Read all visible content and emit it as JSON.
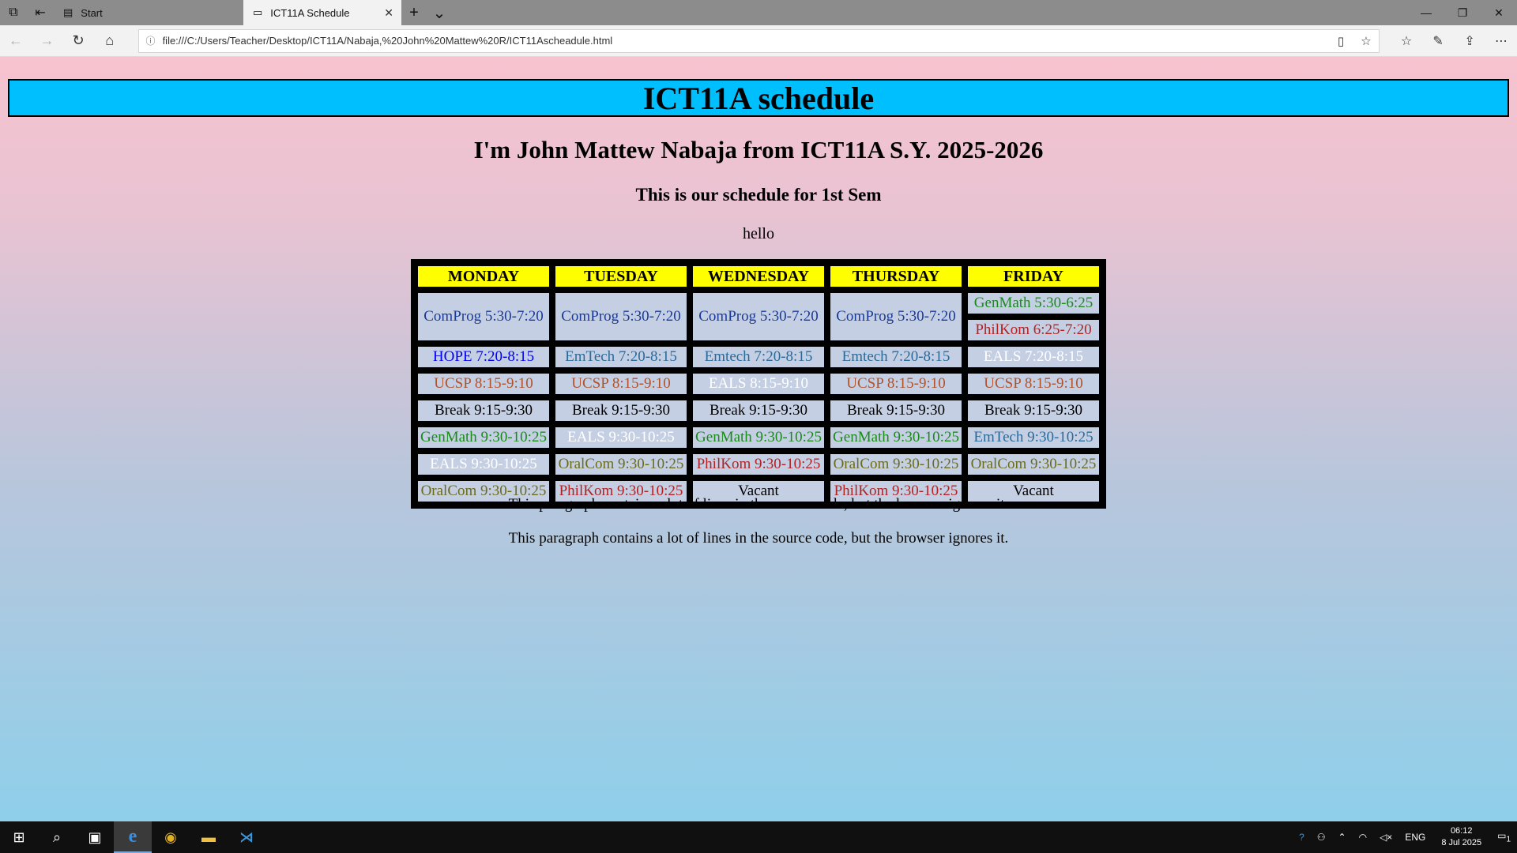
{
  "browser": {
    "tabs": [
      {
        "label": "Start",
        "active": false
      },
      {
        "label": "ICT11A Schedule",
        "active": true
      }
    ],
    "url": "file:///C:/Users/Teacher/Desktop/ICT11A/Nabaja,%20John%20Mattew%20R/ICT11Ascheadule.html"
  },
  "page": {
    "banner": "ICT11A schedule",
    "heading": "I'm John Mattew Nabaja from ICT11A S.Y. 2025-2026",
    "subheading": "This is our schedule for 1st Sem",
    "greeting": "hello",
    "paragraph1": "This paragraph contains a lot of lines in the source code, but the browser ignores it.",
    "paragraph2": "This paragraph contains a lot of lines in the source code, but the browser ignores it."
  },
  "schedule": {
    "days": [
      "MONDAY",
      "TUESDAY",
      "WEDNESDAY",
      "THURSDAY",
      "FRIDAY"
    ],
    "row1": {
      "mon": "ComProg 5:30-7:20",
      "tue": "ComProg 5:30-7:20",
      "wed": "ComProg 5:30-7:20",
      "thu": "ComProg 5:30-7:20",
      "fri_a": "GenMath 5:30-6:25",
      "fri_b": "PhilKom 6:25-7:20"
    },
    "rows": [
      [
        "HOPE 7:20-8:15",
        "EmTech 7:20-8:15",
        "Emtech 7:20-8:15",
        "Emtech 7:20-8:15",
        "EALS 7:20-8:15"
      ],
      [
        "UCSP 8:15-9:10",
        "UCSP 8:15-9:10",
        "EALS 8:15-9:10",
        "UCSP 8:15-9:10",
        "UCSP 8:15-9:10"
      ],
      [
        "Break 9:15-9:30",
        "Break 9:15-9:30",
        "Break 9:15-9:30",
        "Break 9:15-9:30",
        "Break 9:15-9:30"
      ],
      [
        "GenMath 9:30-10:25",
        "EALS 9:30-10:25",
        "GenMath 9:30-10:25",
        "GenMath 9:30-10:25",
        "EmTech 9:30-10:25"
      ],
      [
        "EALS 9:30-10:25",
        "OralCom 9:30-10:25",
        "PhilKom 9:30-10:25",
        "OralCom 9:30-10:25",
        "OralCom 9:30-10:25"
      ],
      [
        "OralCom 9:30-10:25",
        "PhilKom 9:30-10:25",
        "Vacant",
        "PhilKom 9:30-10:25",
        "Vacant"
      ]
    ],
    "subject_colors": {
      "ComProg": "#1a3a9a",
      "GenMath": "#1a8a1a",
      "PhilKom": "#b22222",
      "HOPE": "#0000ee",
      "EmTech": "#2a6a9a",
      "EALS": "#ffffff",
      "UCSP": "#b0522a",
      "Break": "#000000",
      "OralCom": "#6b6b1a",
      "Vacant": "#000000"
    }
  },
  "taskbar": {
    "language": "ENG",
    "time": "06:12",
    "date": "8 Jul 2025",
    "notification_count": "1"
  }
}
